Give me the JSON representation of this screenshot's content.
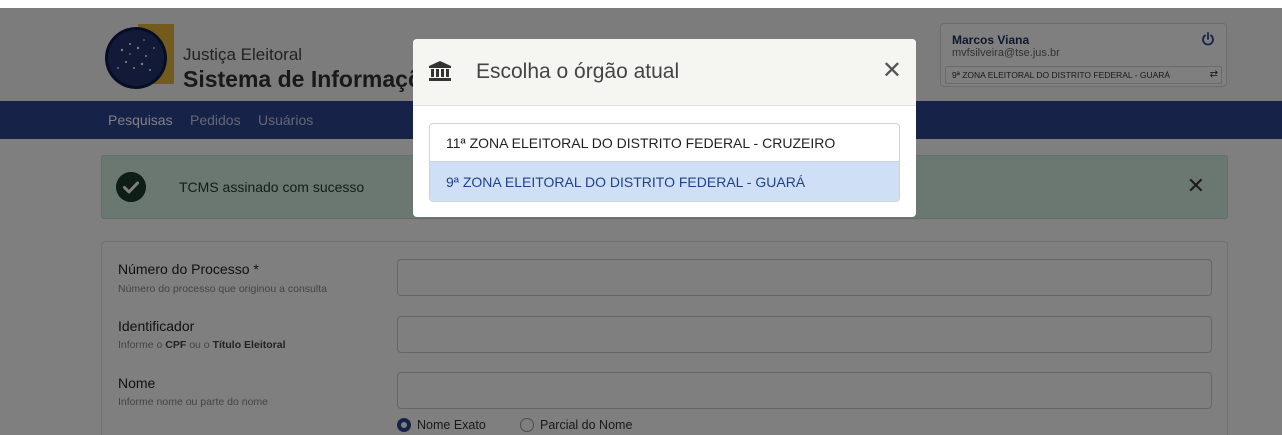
{
  "brand": {
    "subtitle": "Justiça Eleitoral",
    "title": "Sistema de Informações"
  },
  "user": {
    "name": "Marcos Viana",
    "email": "mvfsilveira@tse.jus.br",
    "current_org": "9ª ZONA ELEITORAL DO DISTRITO FEDERAL - GUARÁ"
  },
  "nav": {
    "items": [
      {
        "label": "Pesquisas"
      },
      {
        "label": "Pedidos"
      },
      {
        "label": "Usuários"
      }
    ]
  },
  "alert": {
    "message": "TCMS assinado com sucesso"
  },
  "form": {
    "fields": [
      {
        "label": "Número do Processo *",
        "hint": "Número do processo que originou a consulta",
        "value": ""
      },
      {
        "label": "Identificador",
        "hint_prefix": "Informe o ",
        "hint_b1": "CPF",
        "hint_mid": " ou o ",
        "hint_b2": "Título Eleitoral",
        "value": ""
      },
      {
        "label": "Nome",
        "hint": "Informe nome ou parte do nome",
        "value": ""
      }
    ],
    "radios": [
      {
        "label": "Nome Exato",
        "checked": true
      },
      {
        "label": "Parcial do Nome",
        "checked": false
      }
    ]
  },
  "modal": {
    "title": "Escolha o órgão atual",
    "options": [
      {
        "label": "11ª ZONA ELEITORAL DO DISTRITO FEDERAL - CRUZEIRO",
        "active": false
      },
      {
        "label": "9ª ZONA ELEITORAL DO DISTRITO FEDERAL - GUARÁ",
        "active": true
      }
    ]
  },
  "colors": {
    "navbar": "#2e4592",
    "alert_bg": "#d6eee3",
    "active_option_bg": "#cfe0f6"
  }
}
